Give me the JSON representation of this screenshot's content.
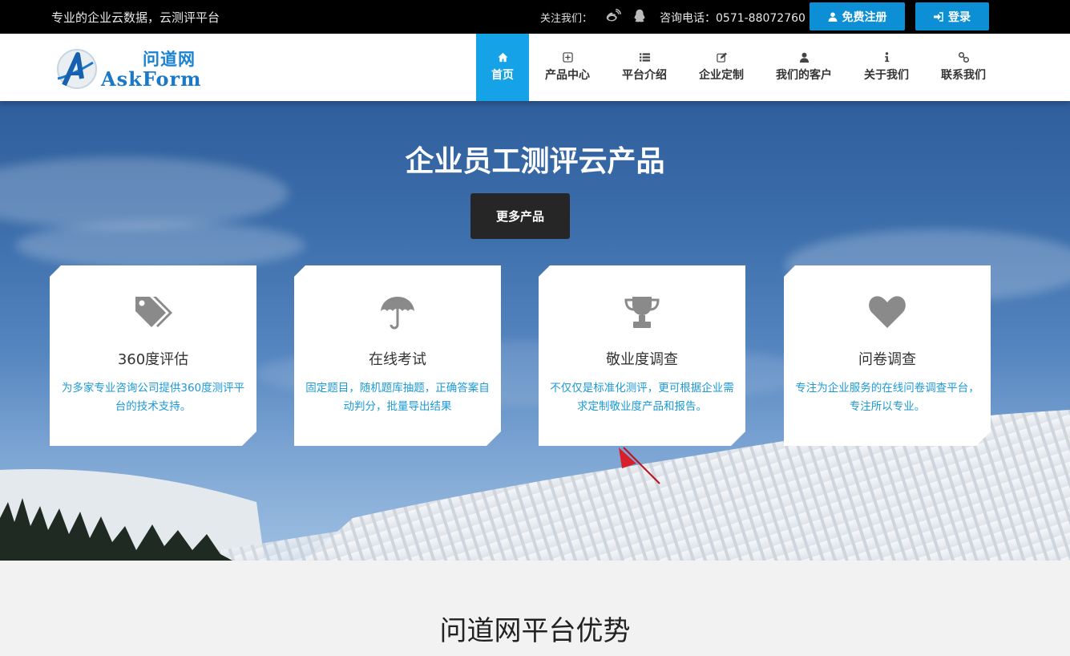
{
  "topbar": {
    "slogan": "专业的企业云数据，云测评平台",
    "follow_label": "关注我们：",
    "icons": [
      "weibo-icon",
      "qq-icon"
    ],
    "phone": "咨询电话：0571-88072760",
    "register_label": "免费注册",
    "login_label": "登录"
  },
  "logo": {
    "cn": "问道网",
    "en": "AskForm"
  },
  "nav": [
    {
      "label": "首页",
      "icon": "home-icon",
      "active": true
    },
    {
      "label": "产品中心",
      "icon": "plus-square-icon"
    },
    {
      "label": "平台介绍",
      "icon": "list-icon"
    },
    {
      "label": "企业定制",
      "icon": "edit-icon"
    },
    {
      "label": "我们的客户",
      "icon": "user-icon"
    },
    {
      "label": "关于我们",
      "icon": "info-icon"
    },
    {
      "label": "联系我们",
      "icon": "link-icon"
    }
  ],
  "hero": {
    "title": "企业员工测评云产品",
    "button": "更多产品",
    "cards": [
      {
        "icon": "tags-icon",
        "title": "360度评估",
        "desc": "为多家专业咨询公司提供360度测评平台的技术支持。"
      },
      {
        "icon": "umbrella-icon",
        "title": "在线考试",
        "desc": "固定题目，随机题库抽题，正确答案自动判分，批量导出结果"
      },
      {
        "icon": "trophy-icon",
        "title": "敬业度调查",
        "desc": "不仅仅是标准化测评，更可根据企业需求定制敬业度产品和报告。"
      },
      {
        "icon": "heart-icon",
        "title": "问卷调查",
        "desc": "专注为企业服务的在线问卷调查平台，专注所以专业。"
      }
    ]
  },
  "section": {
    "title": "问道网平台优势"
  },
  "colors": {
    "accent": "#15a2e6",
    "button_blue": "#0d8fd6",
    "desc_blue": "#1c9ad6",
    "topbar": "#000000"
  }
}
